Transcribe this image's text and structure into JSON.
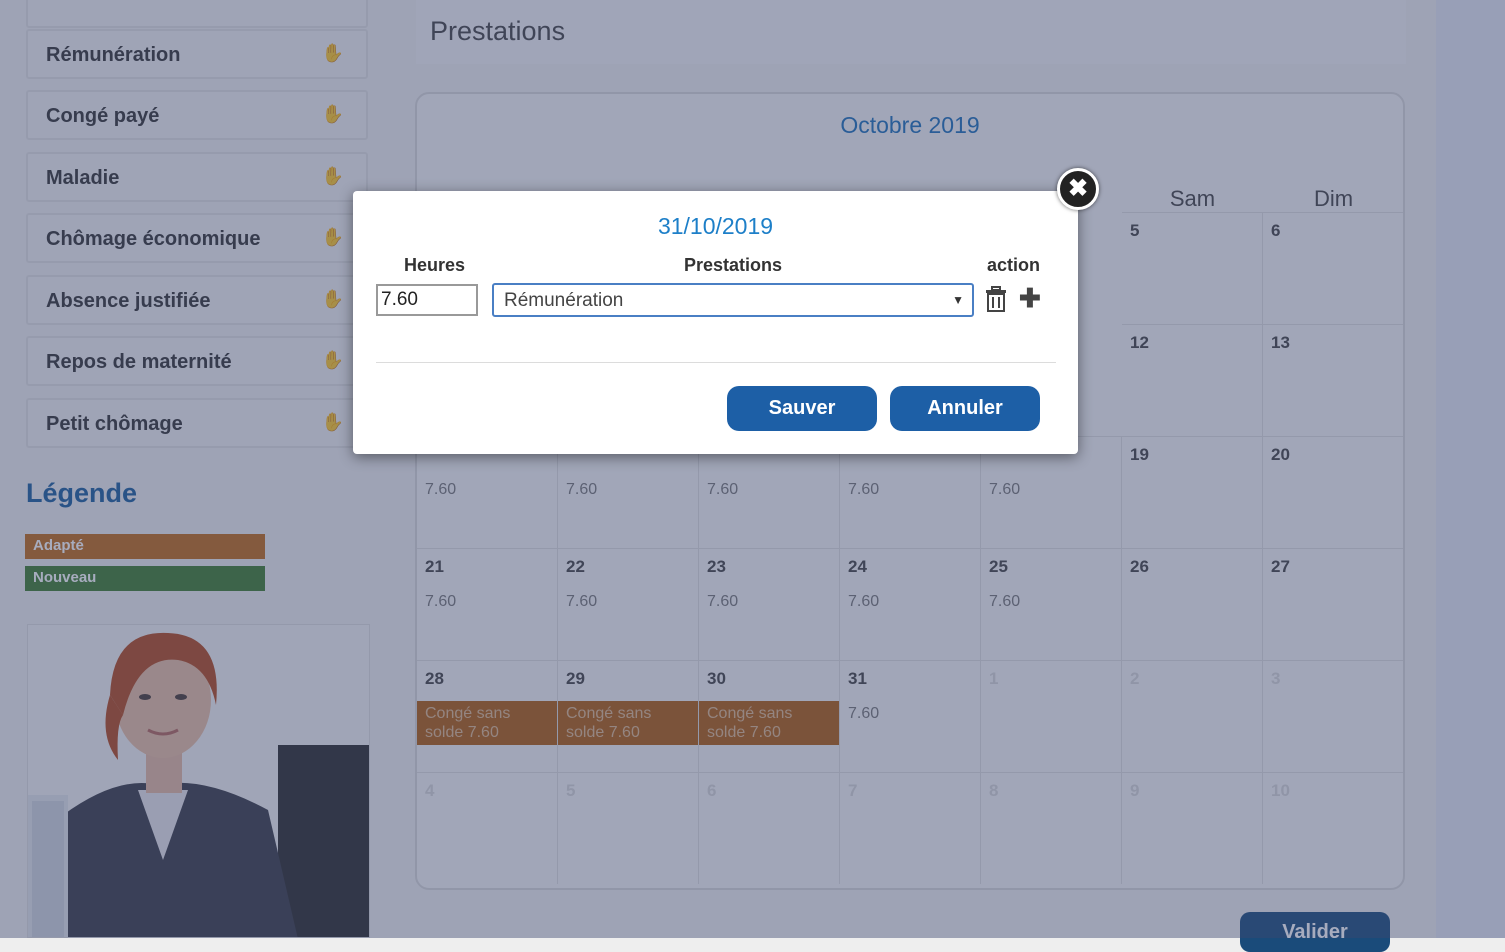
{
  "sidebar": {
    "items": [
      {
        "label": "Rémunération",
        "icon": "hand-icon"
      },
      {
        "label": "Congé payé",
        "icon": "hand-icon"
      },
      {
        "label": "Maladie",
        "icon": "hand-icon"
      },
      {
        "label": "Chômage économique",
        "icon": "hand-icon"
      },
      {
        "label": "Absence justifiée",
        "icon": "hand-icon"
      },
      {
        "label": "Repos de maternité",
        "icon": "hand-icon"
      },
      {
        "label": "Petit chômage",
        "icon": "hand-icon"
      }
    ],
    "legend_title": "Légende",
    "legend": [
      {
        "label": "Adapté",
        "color": "#c06a17"
      },
      {
        "label": "Nouveau",
        "color": "#3f7d2c"
      }
    ]
  },
  "page": {
    "title": "Prestations"
  },
  "calendar": {
    "month": "Octobre 2019",
    "day_headers": [
      "Sam",
      "Dim"
    ],
    "rows": [
      [
        {
          "day": "5"
        },
        {
          "day": "6"
        }
      ],
      [
        {
          "day": "12"
        },
        {
          "day": "13"
        }
      ],
      [
        {
          "day": "",
          "hours": "7.60"
        },
        {
          "day": "",
          "hours": "7.60"
        },
        {
          "day": "",
          "hours": "7.60"
        },
        {
          "day": "",
          "hours": "7.60"
        },
        {
          "day": "",
          "hours": "7.60"
        },
        {
          "day": "19"
        },
        {
          "day": "20"
        }
      ],
      [
        {
          "day": "21",
          "hours": "7.60"
        },
        {
          "day": "22",
          "hours": "7.60"
        },
        {
          "day": "23",
          "hours": "7.60"
        },
        {
          "day": "24",
          "hours": "7.60"
        },
        {
          "day": "25",
          "hours": "7.60"
        },
        {
          "day": "26"
        },
        {
          "day": "27"
        }
      ],
      [
        {
          "day": "28",
          "conge": "Congé sans solde 7.60"
        },
        {
          "day": "29",
          "conge": "Congé sans solde 7.60"
        },
        {
          "day": "30",
          "conge": "Congé sans solde 7.60"
        },
        {
          "day": "31",
          "hours": "7.60"
        },
        {
          "day": "1",
          "faded": true
        },
        {
          "day": "2",
          "faded": true
        },
        {
          "day": "3",
          "faded": true
        }
      ],
      [
        {
          "day": "4",
          "faded": true
        },
        {
          "day": "5",
          "faded": true
        },
        {
          "day": "6",
          "faded": true
        },
        {
          "day": "7",
          "faded": true
        },
        {
          "day": "8",
          "faded": true
        },
        {
          "day": "9",
          "faded": true
        },
        {
          "day": "10",
          "faded": true
        }
      ]
    ]
  },
  "valider_label": "Valider",
  "modal": {
    "date": "31/10/2019",
    "col_hours": "Heures",
    "col_prestations": "Prestations",
    "col_action": "action",
    "hours_value": "7.60",
    "prestation_value": "Rémunération",
    "save_label": "Sauver",
    "cancel_label": "Annuler",
    "close_label": "✖"
  }
}
